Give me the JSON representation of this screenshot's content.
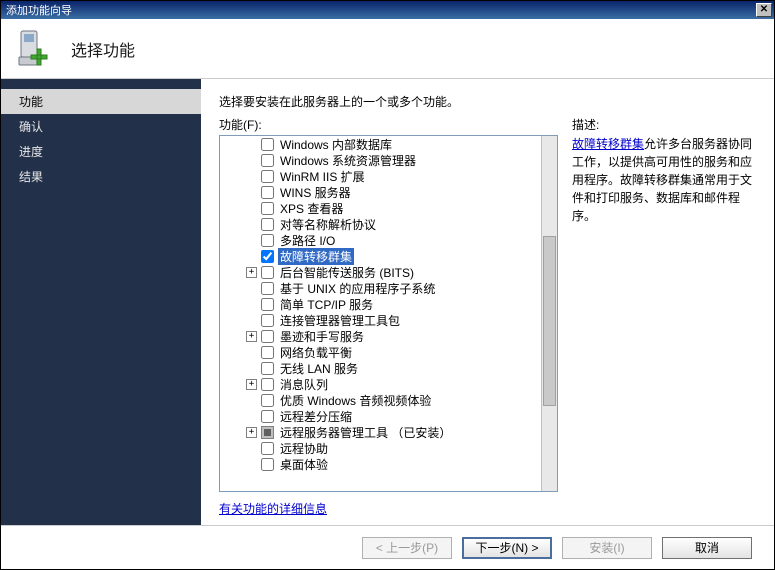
{
  "title": "添加功能向导",
  "header": {
    "title": "选择功能"
  },
  "sidebar": {
    "items": [
      {
        "label": "功能",
        "active": true
      },
      {
        "label": "确认"
      },
      {
        "label": "进度"
      },
      {
        "label": "结果"
      }
    ]
  },
  "main": {
    "instruction": "选择要安装在此服务器上的一个或多个功能。",
    "features_label": "功能(F):",
    "desc_label": "描述:",
    "desc_link": "故障转移群集",
    "desc_text": "允许多台服务器协同工作，以提供高可用性的服务和应用程序。故障转移群集通常用于文件和打印服务、数据库和邮件程序。",
    "more_link": "有关功能的详细信息",
    "features": [
      {
        "label": "Windows 内部数据库",
        "checked": false
      },
      {
        "label": "Windows 系统资源管理器",
        "checked": false
      },
      {
        "label": "WinRM IIS 扩展",
        "checked": false
      },
      {
        "label": "WINS 服务器",
        "checked": false
      },
      {
        "label": "XPS 查看器",
        "checked": false
      },
      {
        "label": "对等名称解析协议",
        "checked": false
      },
      {
        "label": "多路径 I/O",
        "checked": false
      },
      {
        "label": "故障转移群集",
        "checked": true,
        "selected": true
      },
      {
        "label": "后台智能传送服务 (BITS)",
        "checked": false,
        "expandable": true
      },
      {
        "label": "基于 UNIX 的应用程序子系统",
        "checked": false
      },
      {
        "label": "简单 TCP/IP 服务",
        "checked": false
      },
      {
        "label": "连接管理器管理工具包",
        "checked": false
      },
      {
        "label": "墨迹和手写服务",
        "checked": false,
        "expandable": true
      },
      {
        "label": "网络负载平衡",
        "checked": false
      },
      {
        "label": "无线 LAN 服务",
        "checked": false
      },
      {
        "label": "消息队列",
        "checked": false,
        "expandable": true
      },
      {
        "label": "优质 Windows 音频视频体验",
        "checked": false
      },
      {
        "label": "远程差分压缩",
        "checked": false
      },
      {
        "label": "远程服务器管理工具  （已安装）",
        "checked": false,
        "expandable": true,
        "installed": true
      },
      {
        "label": "远程协助",
        "checked": false
      },
      {
        "label": "桌面体验",
        "checked": false
      }
    ]
  },
  "buttons": {
    "prev": "< 上一步(P)",
    "next": "下一步(N) >",
    "install": "安装(I)",
    "cancel": "取消"
  }
}
